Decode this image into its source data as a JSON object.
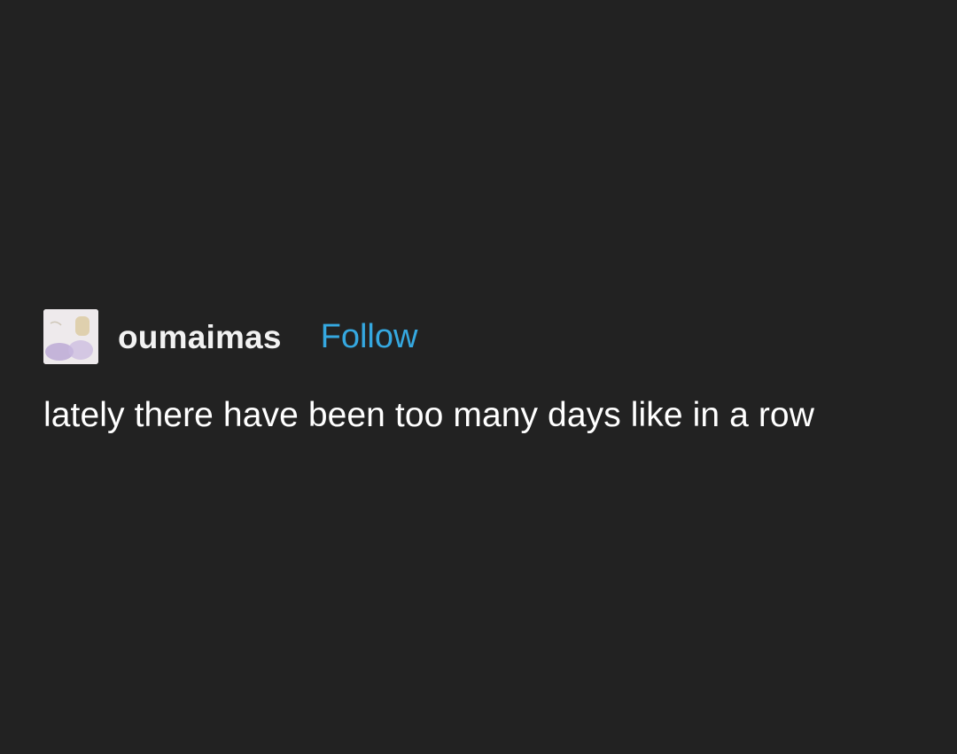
{
  "post": {
    "author": {
      "username": "oumaimas",
      "avatar_icon": "avatar-illustration"
    },
    "follow_label": "Follow",
    "text": "lately there have been too many days like in a row"
  },
  "colors": {
    "background": "#222222",
    "username": "#f2f2f2",
    "follow": "#35a8e0",
    "body_text": "#ffffff"
  }
}
